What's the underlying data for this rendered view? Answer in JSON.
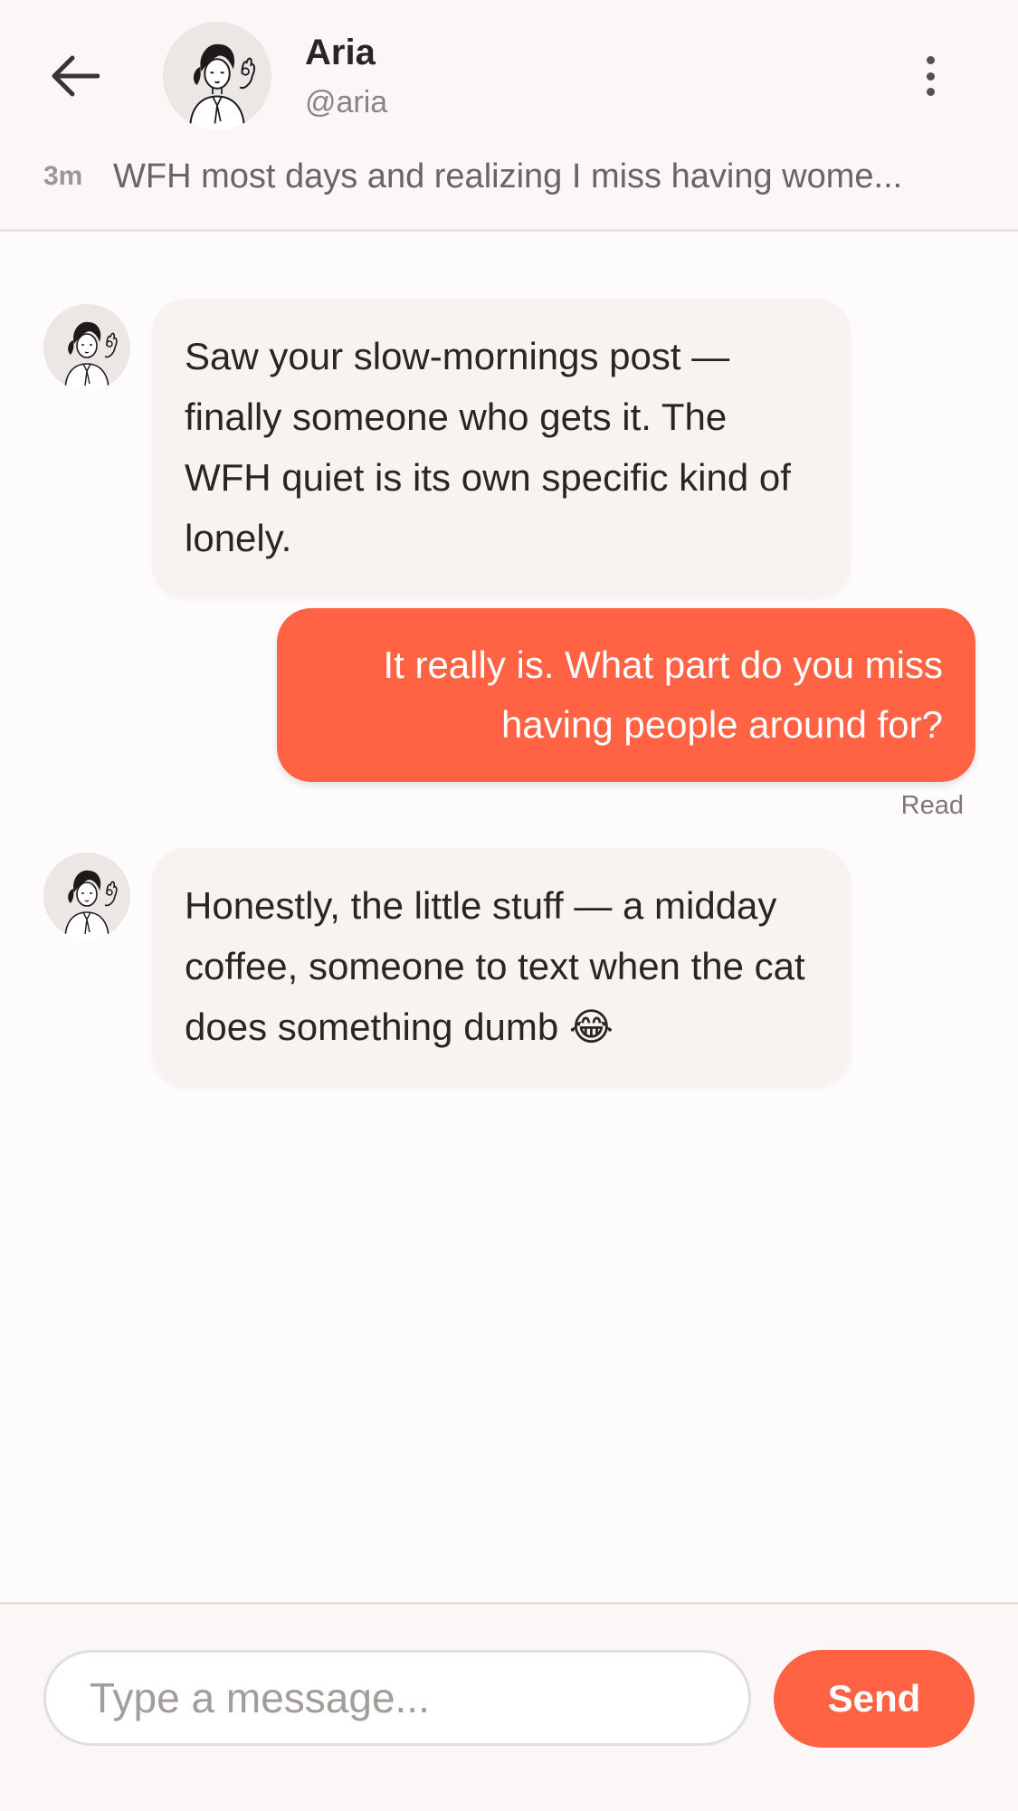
{
  "header": {
    "name": "Aria",
    "handle": "@aria",
    "back_icon": "arrow-left-icon",
    "menu_icon": "more-vertical-icon",
    "context": {
      "time": "3m",
      "text": "WFH most days and realizing I miss having wome..."
    }
  },
  "messages": [
    {
      "direction": "incoming",
      "text": "Saw your slow-mornings post — finally someone who gets it. The WFH quiet is its own specific kind of lonely."
    },
    {
      "direction": "outgoing",
      "text": "It really is. What part do you miss having people around for?",
      "status": "Read"
    },
    {
      "direction": "incoming",
      "text": "Honestly, the little stuff — a midday coffee, someone to text when the cat does something dumb 😂"
    }
  ],
  "composer": {
    "placeholder": "Type a message...",
    "value": "",
    "send_label": "Send"
  },
  "colors": {
    "accent": "#ff6344",
    "incoming_bubble": "#f8f3f1",
    "background": "#fdfbfb",
    "header_bg": "#faf7f6"
  }
}
